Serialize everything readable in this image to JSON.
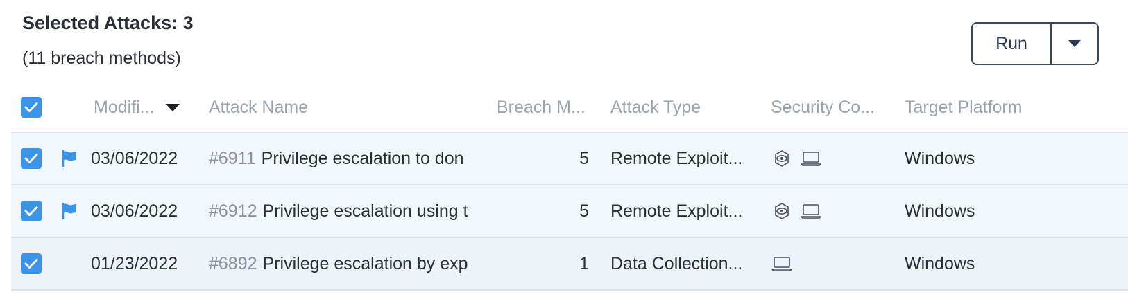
{
  "summary": {
    "title": "Selected Attacks: 3",
    "subtitle": "(11 breach methods)"
  },
  "actions": {
    "run_label": "Run"
  },
  "colors": {
    "accent": "#3a95e8",
    "row_bg": "#f2f7fd",
    "border": "#dde2ea"
  },
  "table": {
    "headers": {
      "modified": "Modifi...",
      "attack_name": "Attack Name",
      "breach_methods": "Breach M...",
      "attack_type": "Attack Type",
      "security_controls": "Security Co...",
      "target_platform": "Target Platform"
    },
    "rows": [
      {
        "flagged": true,
        "modified": "03/06/2022",
        "id": "#6911",
        "name": "Privilege escalation to don",
        "breach_methods": "5",
        "attack_type": "Remote Exploit...",
        "controls": [
          "network-sensor-icon",
          "endpoint-laptop-icon"
        ],
        "platform": "Windows"
      },
      {
        "flagged": true,
        "modified": "03/06/2022",
        "id": "#6912",
        "name": "Privilege escalation using t",
        "breach_methods": "5",
        "attack_type": "Remote Exploit...",
        "controls": [
          "network-sensor-icon",
          "endpoint-laptop-icon"
        ],
        "platform": "Windows"
      },
      {
        "flagged": false,
        "modified": "01/23/2022",
        "id": "#6892",
        "name": "Privilege escalation by exp",
        "breach_methods": "1",
        "attack_type": "Data Collection...",
        "controls": [
          "endpoint-laptop-icon"
        ],
        "platform": "Windows"
      }
    ]
  }
}
